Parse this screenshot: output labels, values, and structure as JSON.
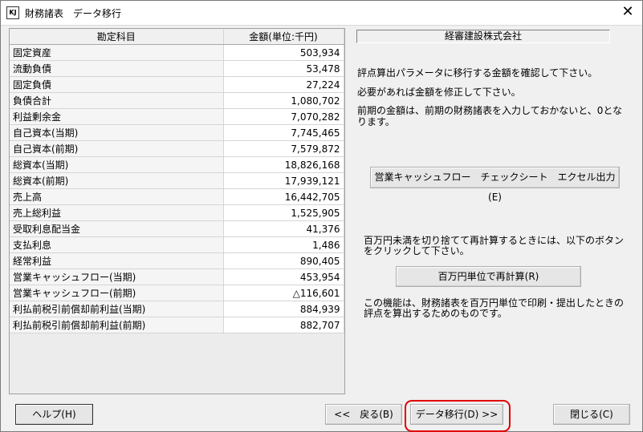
{
  "window": {
    "title": "財務諸表　データ移行",
    "icon_text": "KJ"
  },
  "table": {
    "headers": [
      "勘定科目",
      "金額(単位:千円)"
    ],
    "rows": [
      {
        "name": "固定資産",
        "amount": "503,934"
      },
      {
        "name": "流動負債",
        "amount": "53,478"
      },
      {
        "name": "固定負債",
        "amount": "27,224"
      },
      {
        "name": "負債合計",
        "amount": "1,080,702"
      },
      {
        "name": "利益剰余金",
        "amount": "7,070,282"
      },
      {
        "name": "自己資本(当期)",
        "amount": "7,745,465"
      },
      {
        "name": "自己資本(前期)",
        "amount": "7,579,872"
      },
      {
        "name": "総資本(当期)",
        "amount": "18,826,168"
      },
      {
        "name": "総資本(前期)",
        "amount": "17,939,121"
      },
      {
        "name": "売上高",
        "amount": "16,442,705"
      },
      {
        "name": "売上総利益",
        "amount": "1,525,905"
      },
      {
        "name": "受取利息配当金",
        "amount": "41,376"
      },
      {
        "name": "支払利息",
        "amount": "1,486"
      },
      {
        "name": "経常利益",
        "amount": "890,405"
      },
      {
        "name": "営業キャッシュフロー(当期)",
        "amount": "453,954"
      },
      {
        "name": "営業キャッシュフロー(前期)",
        "amount": "△116,601"
      },
      {
        "name": "利払前税引前償却前利益(当期)",
        "amount": "884,939"
      },
      {
        "name": "利払前税引前償却前利益(前期)",
        "amount": "882,707"
      }
    ]
  },
  "right": {
    "company": "経審建設株式会社",
    "msg1": "評点算出パラメータに移行する金額を確認して下さい。",
    "msg2": "必要があれば金額を修正して下さい。",
    "msg3_line1": "前期の金額は、前期の財務諸表を入力しておかないと、0とな",
    "msg3_line2": "ります。",
    "cf_button": "営業キャッシュフロー　チェックシート　エクセル出力(E)",
    "recalc_msg_line1": "百万円未満を切り捨てて再計算するときには、以下のボタン",
    "recalc_msg_line2": "をクリックして下さい。",
    "recalc_button": "百万円単位で再計算(R)",
    "note_line1": "この機能は、財務諸表を百万円単位で印刷・提出したときの",
    "note_line2": "評点を算出するためのものです。"
  },
  "footer": {
    "help": "ヘルプ(H)",
    "back": "<<　戻る(B)",
    "next": "データ移行(D) >>",
    "close": "閉じる(C)"
  },
  "colors": {
    "highlight": "#e00000"
  }
}
